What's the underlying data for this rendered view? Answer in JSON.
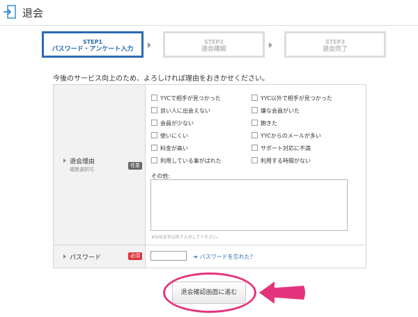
{
  "header": {
    "title": "退会",
    "icon": "exit-door-icon"
  },
  "steps": [
    {
      "label": "STEP1",
      "name": "パスワード・アンケート入力",
      "active": true
    },
    {
      "label": "STEP2",
      "name": "退会確認",
      "active": false
    },
    {
      "label": "STEP3",
      "name": "退会完了",
      "active": false
    }
  ],
  "intro_text": "今後のサービス向上のため、よろしければ理由をおきかせください。",
  "reason": {
    "label": "退会理由",
    "sublabel": "複数選択可",
    "badge": "任意",
    "options_left": [
      "YYCで相手が見つかった",
      "良い人に出会えない",
      "会員が少ない",
      "使いにくい",
      "料金が高い",
      "利用している事がばれた"
    ],
    "options_right": [
      "YYC以外で相手が見つかった",
      "嫌な会員がいた",
      "飽きた",
      "YYCからのメールが多い",
      "サポート対応に不満",
      "利用する時間がない"
    ],
    "other_label": "その他:",
    "other_value": "",
    "hint": "※500文字以内で入力してください。"
  },
  "password": {
    "label": "パスワード",
    "badge": "必須",
    "value": "",
    "forgot_link": "パスワードを忘れた？"
  },
  "proceed_button": "退会確認画面に進む",
  "colors": {
    "accent_blue": "#2a6ab2",
    "highlight_pink": "#e4347d",
    "required_red": "#e0333a",
    "optional_gray": "#666666"
  }
}
